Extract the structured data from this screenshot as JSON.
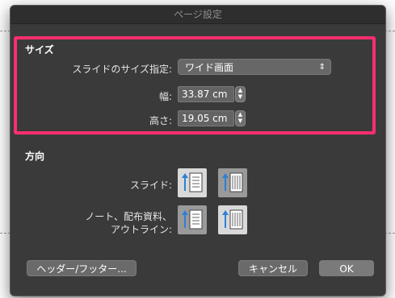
{
  "window": {
    "title": "ページ設定"
  },
  "size_section": {
    "title": "サイズ",
    "slide_size_label": "スライドのサイズ指定:",
    "slide_size_value": "ワイド画面",
    "width_label": "幅:",
    "width_value": "33.87 cm",
    "height_label": "高さ:",
    "height_value": "19.05 cm"
  },
  "orientation_section": {
    "title": "方向",
    "slide_label": "スライド:",
    "notes_label_line1": "ノート、配布資料、",
    "notes_label_line2": "アウトライン:"
  },
  "buttons": {
    "header_footer": "ヘッダー/フッター...",
    "cancel": "キャンセル",
    "ok": "OK"
  },
  "colors": {
    "highlight": "#ff2e6f",
    "arrow": "#2f7fd6"
  }
}
